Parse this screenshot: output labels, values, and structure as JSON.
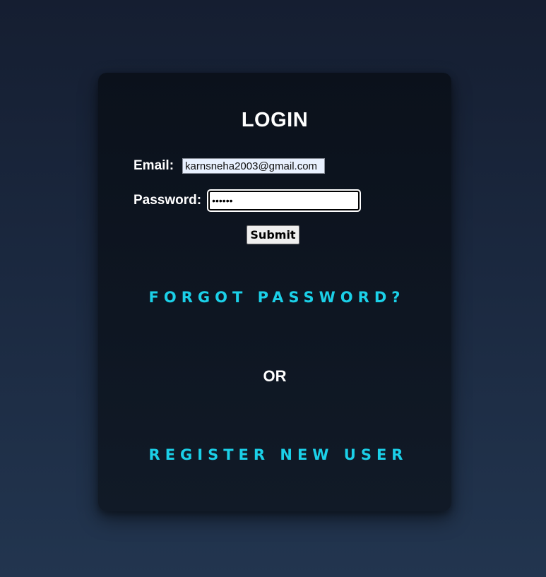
{
  "login": {
    "title": "LOGIN",
    "email_label": "Email:",
    "email_value": "karnsneha2003@gmail.com",
    "password_label": "Password:",
    "password_value": "••••••",
    "submit_label": "Submit",
    "forgot_link": "FORGOT PASSWORD?",
    "separator": "OR",
    "register_link": "REGISTER NEW USER"
  },
  "colors": {
    "page_background": "#1b2940",
    "card_background": "#0e1622",
    "link_accent": "#1bd0e8",
    "text": "#ffffff"
  }
}
